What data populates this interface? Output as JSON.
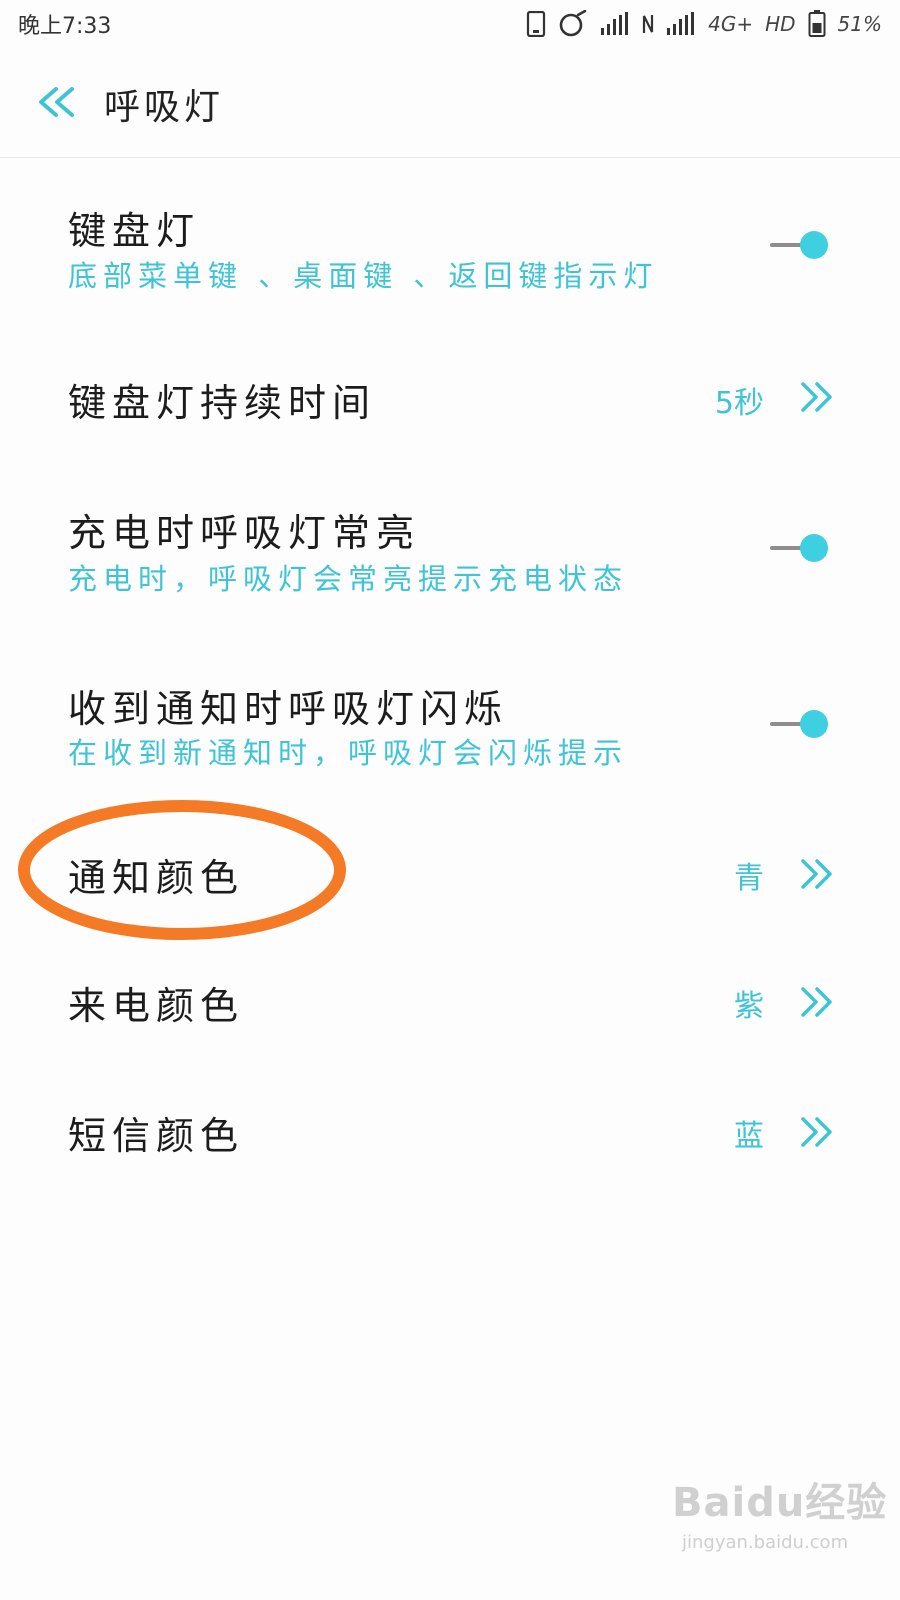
{
  "status_bar": {
    "time": "晚上7:33",
    "network": "4G+",
    "hd": "HD",
    "battery": "51%"
  },
  "header": {
    "title": "呼吸灯",
    "back_icon": "double-chevron-left-icon"
  },
  "settings": [
    {
      "title": "键盘灯",
      "subtitle": "底部菜单键 、桌面键 、返回键指示灯",
      "control": "toggle",
      "on": true
    },
    {
      "title": "键盘灯持续时间",
      "value": "5秒",
      "control": "chevron"
    },
    {
      "title": "充电时呼吸灯常亮",
      "subtitle": "充电时，呼吸灯会常亮提示充电状态",
      "control": "toggle",
      "on": true
    },
    {
      "title": "收到通知时呼吸灯闪烁",
      "subtitle": "在收到新通知时，呼吸灯会闪烁提示",
      "control": "toggle",
      "on": true
    },
    {
      "title": "通知颜色",
      "value": "青",
      "control": "chevron",
      "highlighted": true
    },
    {
      "title": "来电颜色",
      "value": "紫",
      "control": "chevron"
    },
    {
      "title": "短信颜色",
      "value": "蓝",
      "control": "chevron"
    }
  ],
  "watermark": {
    "brand": "Baidu经验",
    "url": "jingyan.baidu.com"
  },
  "colors": {
    "accent": "#3fc4d6",
    "toggle_knob": "#3ecfe0",
    "highlight_ring": "#f47a26"
  }
}
